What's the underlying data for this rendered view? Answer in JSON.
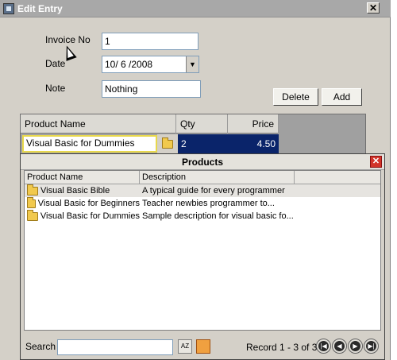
{
  "window": {
    "title": "Edit Entry",
    "close_glyph": "✕"
  },
  "form": {
    "invoice_label": "Invoice No",
    "invoice_value": "1",
    "date_label": "Date",
    "date_value": "10/ 6 /2008",
    "note_label": "Note",
    "note_value": "Nothing"
  },
  "buttons": {
    "delete": "Delete",
    "add": "Add"
  },
  "grid": {
    "headers": [
      "Product Name",
      "Qty",
      "Price"
    ],
    "row": {
      "product": "Visual Basic for Dummies",
      "qty": "2",
      "price": "4.50"
    }
  },
  "popup": {
    "title": "Products",
    "close_glyph": "✕",
    "columns": [
      "Product Name",
      "Description"
    ],
    "rows": [
      {
        "name": "Visual Basic Bible",
        "description": "A typical guide for every programmer"
      },
      {
        "name": "Visual Basic for Beginners",
        "description": "Teacher newbies programmer to..."
      },
      {
        "name": "Visual Basic for Dummies",
        "description": "Sample description for visual basic fo..."
      }
    ],
    "search_label": "Search",
    "search_value": "",
    "sort_icon_text": "AZ",
    "record_text": "Record 1 - 3 of 3",
    "nav": {
      "first": "|◀",
      "prev": "◀",
      "next": "▶",
      "last": "▶|"
    }
  },
  "colors": {
    "selection": "#0a246a",
    "close_red": "#d2342a"
  }
}
